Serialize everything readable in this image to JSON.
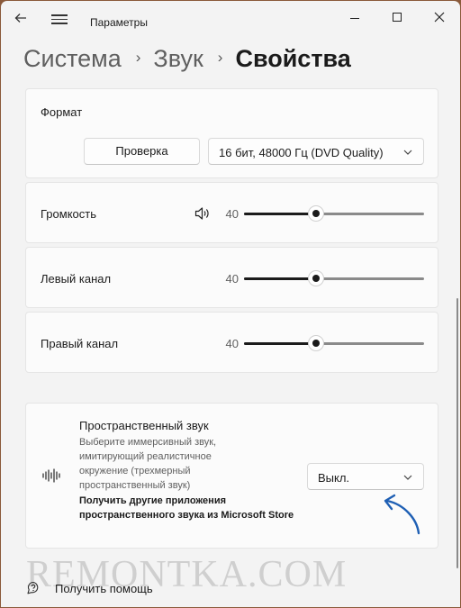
{
  "window": {
    "title": "Параметры",
    "back_icon": "arrow-left-icon",
    "menu_icon": "hamburger-icon",
    "controls": [
      "minimize-icon",
      "maximize-icon",
      "close-icon"
    ]
  },
  "breadcrumb": {
    "items": [
      "Система",
      "Звук"
    ],
    "current": "Свойства",
    "separator": "›"
  },
  "format": {
    "label": "Формат",
    "test_button": "Проверка",
    "format_value": "16 бит, 48000 Гц (DVD Quality)"
  },
  "volume": {
    "label": "Громкость",
    "value": "40",
    "level": 0.4,
    "icon": "speaker-icon"
  },
  "left_channel": {
    "label": "Левый канал",
    "value": "40",
    "level": 0.4
  },
  "right_channel": {
    "label": "Правый канал",
    "value": "40",
    "level": 0.4
  },
  "spatial": {
    "icon": "sound-wave-icon",
    "title": "Пространственный звук",
    "description": "Выберите иммерсивный звук, имитирующий реалистичное окружение (трехмерный пространственный звук)",
    "link": "Получить другие приложения пространственного звука из Microsoft Store",
    "selected": "Выкл."
  },
  "help": {
    "label": "Получить помощь",
    "icon": "help-icon"
  },
  "watermark": "REMONTKA.COM",
  "colors": {
    "accent": "#1b1b1b",
    "arrow": "#1e5fb4",
    "background": "#f3f3f3"
  }
}
